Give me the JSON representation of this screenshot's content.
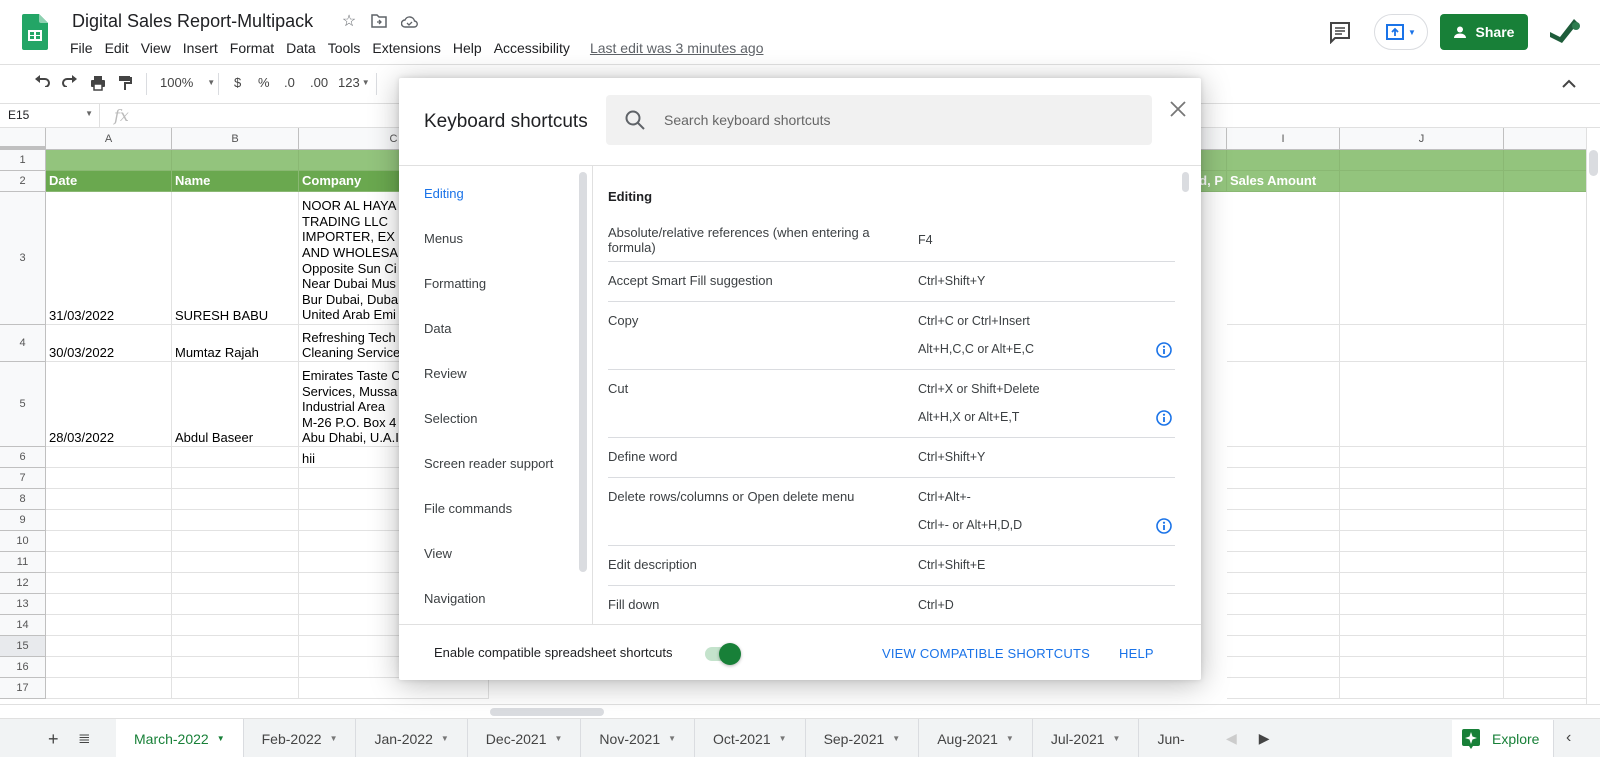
{
  "app": {
    "document_title": "Digital Sales Report-Multipack",
    "menu": [
      "File",
      "Edit",
      "View",
      "Insert",
      "Format",
      "Data",
      "Tools",
      "Extensions",
      "Help",
      "Accessibility"
    ],
    "last_edit": "Last edit was 3 minutes ago",
    "share_label": "Share",
    "colors": {
      "brand_green": "#188038",
      "accent_blue": "#1a73e8",
      "header_green_dark": "#6aa84f",
      "header_green_light": "#93c47d"
    }
  },
  "toolbar": {
    "zoom": "100%",
    "currency": "$",
    "percent": "%",
    "decrease_decimal": ".0",
    "increase_decimal": ".00",
    "more_formats": "123"
  },
  "formula_bar": {
    "name_box": "E15",
    "fx_label": "fx",
    "value": ""
  },
  "grid": {
    "columns": [
      "A",
      "B",
      "C",
      "I",
      "J"
    ],
    "row_numbers": [
      "1",
      "2",
      "3",
      "4",
      "5",
      "6",
      "7",
      "8",
      "9",
      "10",
      "11",
      "12",
      "13",
      "14",
      "15",
      "16",
      "17"
    ],
    "selected_row": "15",
    "header_row": {
      "date": "Date",
      "name": "Name",
      "company": "Company",
      "h_partial": "ed, P",
      "sales_amount": "Sales Amount"
    },
    "rows": [
      {
        "row": "3",
        "date": "31/03/2022",
        "name": "SURESH BABU",
        "company": "NOOR AL HAYA\nTRADING LLC\nIMPORTER, EX\nAND WHOLESA\nOpposite Sun Ci\nNear Dubai Mus\nBur Dubai, Duba\nUnited Arab Emi"
      },
      {
        "row": "4",
        "date": "30/03/2022",
        "name": "Mumtaz Rajah",
        "company": "Refreshing Tech\nCleaning Service"
      },
      {
        "row": "5",
        "date": "28/03/2022",
        "name": "Abdul Baseer",
        "company": "Emirates Taste C\nServices, Mussa\nIndustrial Area\nM-26 P.O. Box 4\nAbu Dhabi, U.A.I"
      },
      {
        "row": "6",
        "date": "",
        "name": "",
        "company": "hii"
      }
    ]
  },
  "sheets": {
    "tabs": [
      "March-2022",
      "Feb-2022",
      "Jan-2022",
      "Dec-2021",
      "Nov-2021",
      "Oct-2021",
      "Sep-2021",
      "Aug-2021",
      "Jul-2021",
      "Jun-"
    ],
    "active": "March-2022",
    "explore_label": "Explore"
  },
  "dialog": {
    "title": "Keyboard shortcuts",
    "search_placeholder": "Search keyboard shortcuts",
    "search_value": "",
    "categories": [
      "Editing",
      "Menus",
      "Formatting",
      "Data",
      "Review",
      "Selection",
      "Screen reader support",
      "File commands",
      "View",
      "Navigation"
    ],
    "active_category": "Editing",
    "section_title": "Editing",
    "shortcuts": [
      {
        "description": "Absolute/relative references (when entering a formula)",
        "keys": [
          "F4"
        ],
        "info": false
      },
      {
        "description": "Accept Smart Fill suggestion",
        "keys": [
          "Ctrl+Shift+Y"
        ],
        "info": false
      },
      {
        "description": "Copy",
        "keys": [
          "Ctrl+C or Ctrl+Insert",
          "Alt+H,C,C or Alt+E,C"
        ],
        "info": true
      },
      {
        "description": "Cut",
        "keys": [
          "Ctrl+X or Shift+Delete",
          "Alt+H,X or Alt+E,T"
        ],
        "info": true
      },
      {
        "description": "Define word",
        "keys": [
          "Ctrl+Shift+Y"
        ],
        "info": false
      },
      {
        "description": "Delete rows/columns or Open delete menu",
        "keys": [
          "Ctrl+Alt+-",
          "Ctrl+- or Alt+H,D,D"
        ],
        "info": true
      },
      {
        "description": "Edit description",
        "keys": [
          "Ctrl+Shift+E"
        ],
        "info": false
      },
      {
        "description": "Fill down",
        "keys": [
          "Ctrl+D"
        ],
        "info": false
      }
    ],
    "footer": {
      "toggle_label": "Enable compatible spreadsheet shortcuts",
      "toggle_on": true,
      "view_compatible": "VIEW COMPATIBLE SHORTCUTS",
      "help": "HELP"
    }
  }
}
